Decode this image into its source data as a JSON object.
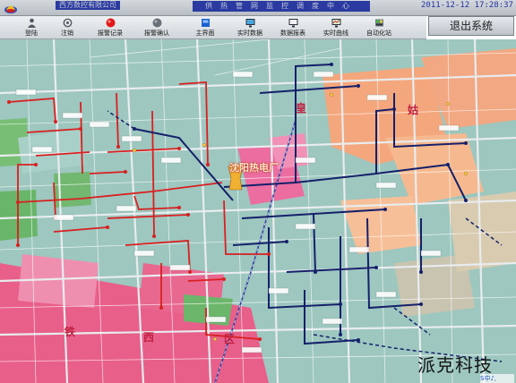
{
  "window": {
    "company": "西方数控有限公司",
    "system_title": "供热管网监控调度中心",
    "datetime": "2011-12-12 17:28:37",
    "exit_label": "退出系统"
  },
  "toolbar": {
    "items": [
      {
        "label": "登陆",
        "icon": "login-icon"
      },
      {
        "label": "注销",
        "icon": "logout-icon"
      },
      {
        "label": "报警记录",
        "icon": "alarm-record-icon"
      },
      {
        "label": "报警确认",
        "icon": "alarm-confirm-icon"
      },
      {
        "label": "主界面",
        "icon": "main-screen-icon"
      },
      {
        "label": "实时数据",
        "icon": "realtime-data-icon"
      },
      {
        "label": "数据报表",
        "icon": "report-icon"
      },
      {
        "label": "实时曲线",
        "icon": "realtime-curve-icon"
      },
      {
        "label": "自动化站",
        "icon": "automation-station-icon"
      }
    ]
  },
  "map": {
    "plant_label": "沈阳热电厂",
    "districts": [
      "皇",
      "姑",
      "铁",
      "西",
      "区"
    ],
    "watermark": "派克科技",
    "ime_bar": "S中♪,"
  },
  "colors": {
    "map_base": "#9dc7bf",
    "block_pink": "#e85f8a",
    "block_green": "#69b56a",
    "block_orange": "#f4a77d",
    "pipe_red": "#d82020",
    "pipe_navy": "#15206a",
    "title_bar": "#2a3aa0"
  }
}
